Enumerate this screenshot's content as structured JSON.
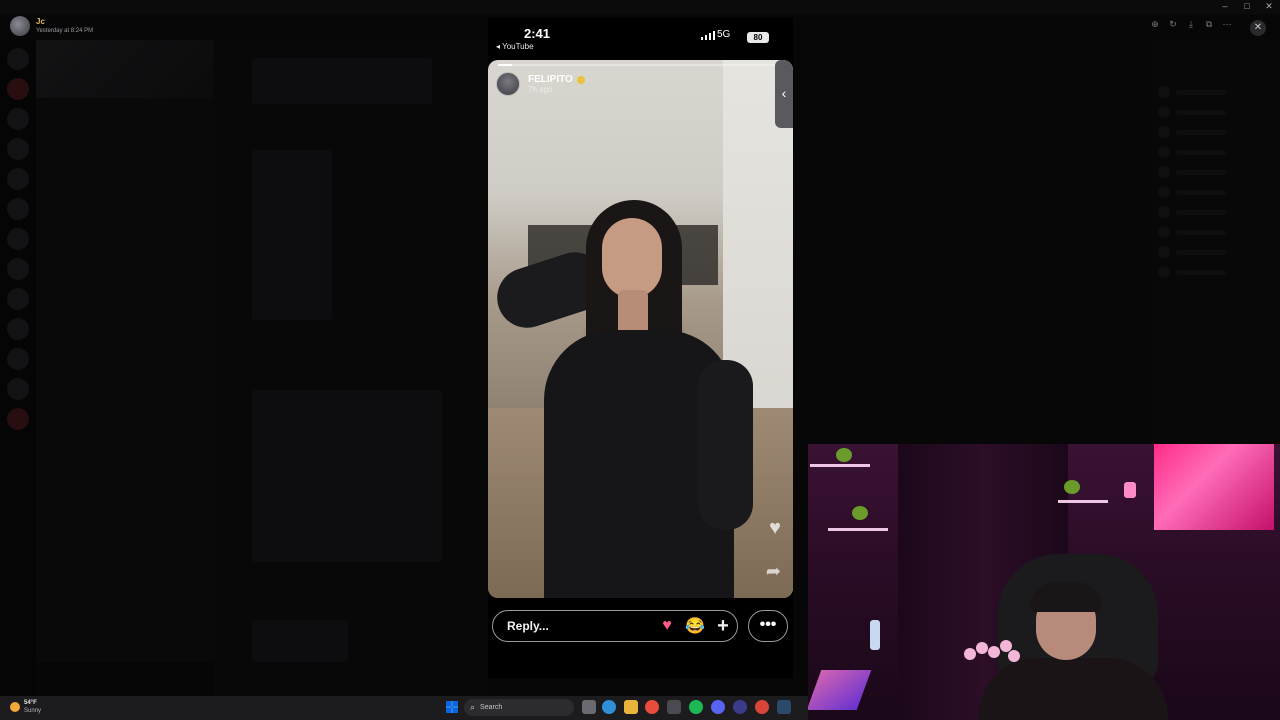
{
  "stream": {
    "poster_name": "Jc",
    "poster_time": "Yesterday at 8:24 PM"
  },
  "viewer_tools": {
    "zoom_icon": "zoom-icon",
    "rotate_icon": "rotate-icon",
    "download_icon": "download-icon",
    "open_icon": "open-external-icon",
    "more_icon": "more-icon",
    "close_icon": "close-icon",
    "close_label": "✕"
  },
  "phone": {
    "time": "2:41",
    "back_label": "◂ YouTube",
    "network": "5G",
    "battery": "80",
    "story": {
      "username": "FELIPITO",
      "age": "7h ago",
      "progress": 0.05,
      "collapse_label": "‹",
      "heart_glyph": "♥",
      "share_glyph": "➦"
    },
    "reply": {
      "placeholder": "Reply...",
      "reactions": [
        "♥",
        "😂",
        "+"
      ],
      "more_label": "•••"
    }
  },
  "taskbar": {
    "temperature": "54°F",
    "condition": "Sunny",
    "search_label": "Search"
  },
  "colors": {
    "accent_gold": "#e0b95a",
    "heart": "#ff5c8a",
    "room_pink": "#ff2c8a"
  }
}
